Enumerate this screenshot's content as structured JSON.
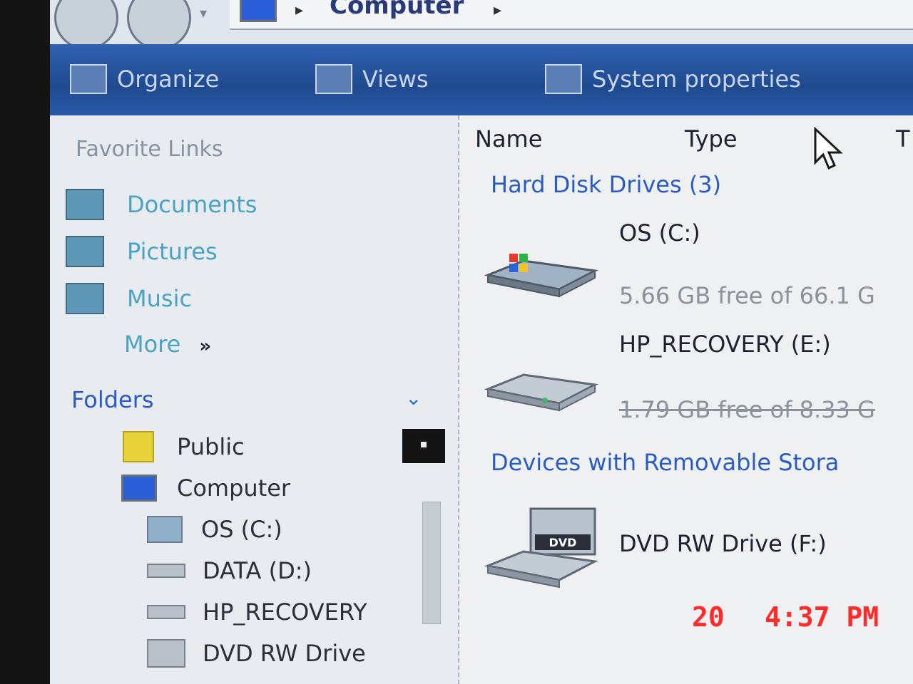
{
  "address_bar": {
    "location": "Computer"
  },
  "toolbar": {
    "items": [
      "Organize",
      "Views",
      "System properties"
    ]
  },
  "nav_pane": {
    "favorite_links_label": "Favorite Links",
    "favorites": [
      "Documents",
      "Pictures",
      "Music"
    ],
    "more_label": "More",
    "folders_label": "Folders",
    "tree": [
      "Public",
      "Computer",
      "OS (C:)",
      "DATA (D:)",
      "HP_RECOVERY",
      "DVD RW Drive"
    ]
  },
  "content": {
    "columns": [
      "Name",
      "Type",
      "T"
    ],
    "groups": [
      {
        "title": "Hard Disk Drives (3)",
        "drives": [
          {
            "name": "OS (C:)",
            "free": "5.66 GB free of 66.1 G"
          },
          {
            "name": "HP_RECOVERY (E:)",
            "free": "1.79 GB free of 8.33 G"
          }
        ]
      },
      {
        "title": "Devices with Removable Stora",
        "drives": [
          {
            "name": "DVD RW Drive (F:)"
          }
        ]
      }
    ]
  },
  "camera_stamp": {
    "date": "20",
    "time": "4:37 PM"
  }
}
